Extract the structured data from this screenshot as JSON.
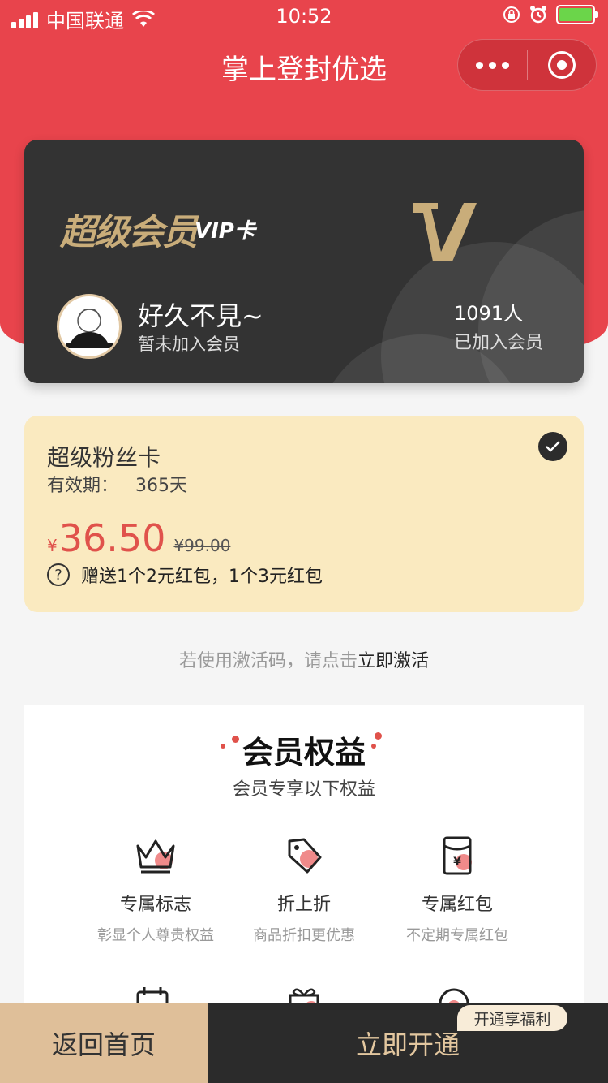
{
  "status_bar": {
    "carrier": "中国联通",
    "time": "10:52"
  },
  "nav": {
    "title": "掌上登封优选"
  },
  "vip_card": {
    "title": "超级会员",
    "card_label": "VIP卡",
    "user_name": "好久不見~",
    "user_status": "暂未加入会员",
    "member_count": "1091人",
    "member_label": "已加入会员"
  },
  "fan_card": {
    "name": "超级粉丝卡",
    "validity_label": "有效期：",
    "validity_value": "365天",
    "currency": "¥",
    "price": "36.50",
    "original_price": "¥99.00",
    "gift": "赠送1个2元红包，1个3元红包"
  },
  "activate": {
    "prefix": "若使用激活码，请点击",
    "link": "立即激活"
  },
  "benefits": {
    "title": "会员权益",
    "subtitle": "会员专享以下权益",
    "items": [
      {
        "name": "专属标志",
        "desc": "彰显个人尊贵权益",
        "icon": "crown-icon"
      },
      {
        "name": "折上折",
        "desc": "商品折扣更优惠",
        "icon": "tag-icon"
      },
      {
        "name": "专属红包",
        "desc": "不定期专属红包",
        "icon": "red-envelope-icon"
      }
    ]
  },
  "bottom": {
    "home": "返回首页",
    "open": "立即开通",
    "badge": "开通享福利"
  },
  "colors": {
    "primary_red": "#e8444c",
    "gold": "#c9ad7a",
    "card_dark": "#333333",
    "fan_card_bg": "#faeac0"
  }
}
